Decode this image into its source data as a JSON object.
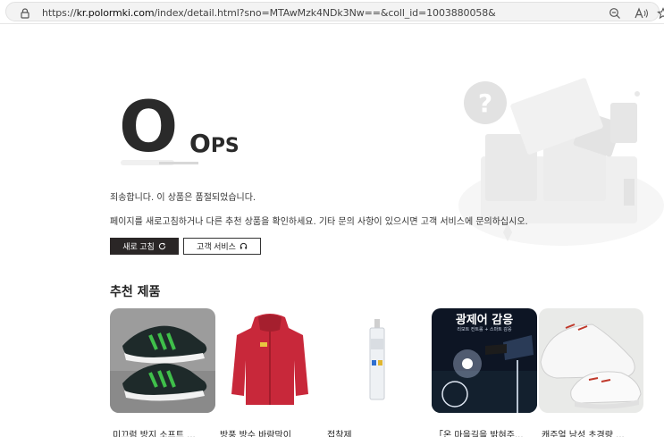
{
  "browser": {
    "url_prefix": "https://",
    "url_host": "kr.polormki.com",
    "url_path": "/index/detail.html?sno=MTAwMzk4NDk3Nw==&coll_id=1003880058&"
  },
  "error": {
    "big_letter": "O",
    "ops_first": "O",
    "ops_rest": "PS",
    "message_1": "죄송합니다. 이 상품은 품절되었습니다.",
    "message_2": "페이지를 새로고침하거나 다른 추천 상품을 확인하세요. 기타 문의 사항이 있으시면 고객 서비스에 문의하십시오."
  },
  "buttons": {
    "refresh_label": "새로 고침",
    "service_label": "고객 서비스"
  },
  "recommend": {
    "title": "추천 제품",
    "products": [
      {
        "name": "미끄럼 방지 소프트 ..."
      },
      {
        "name": "방풍 방수 바람막이"
      },
      {
        "name": "접착제"
      },
      {
        "name": "「온 마을길을 밝혀주...",
        "banner_title": "광제어 감응",
        "banner_sub": "리모트 컨트롤 + 스마트 감응"
      },
      {
        "name": "캐주얼 남성 초경량 ..."
      }
    ]
  },
  "colors": {
    "dark_button": "#2a2626",
    "jacket_red": "#c8283a",
    "shoe_green": "#3fbf4a"
  }
}
